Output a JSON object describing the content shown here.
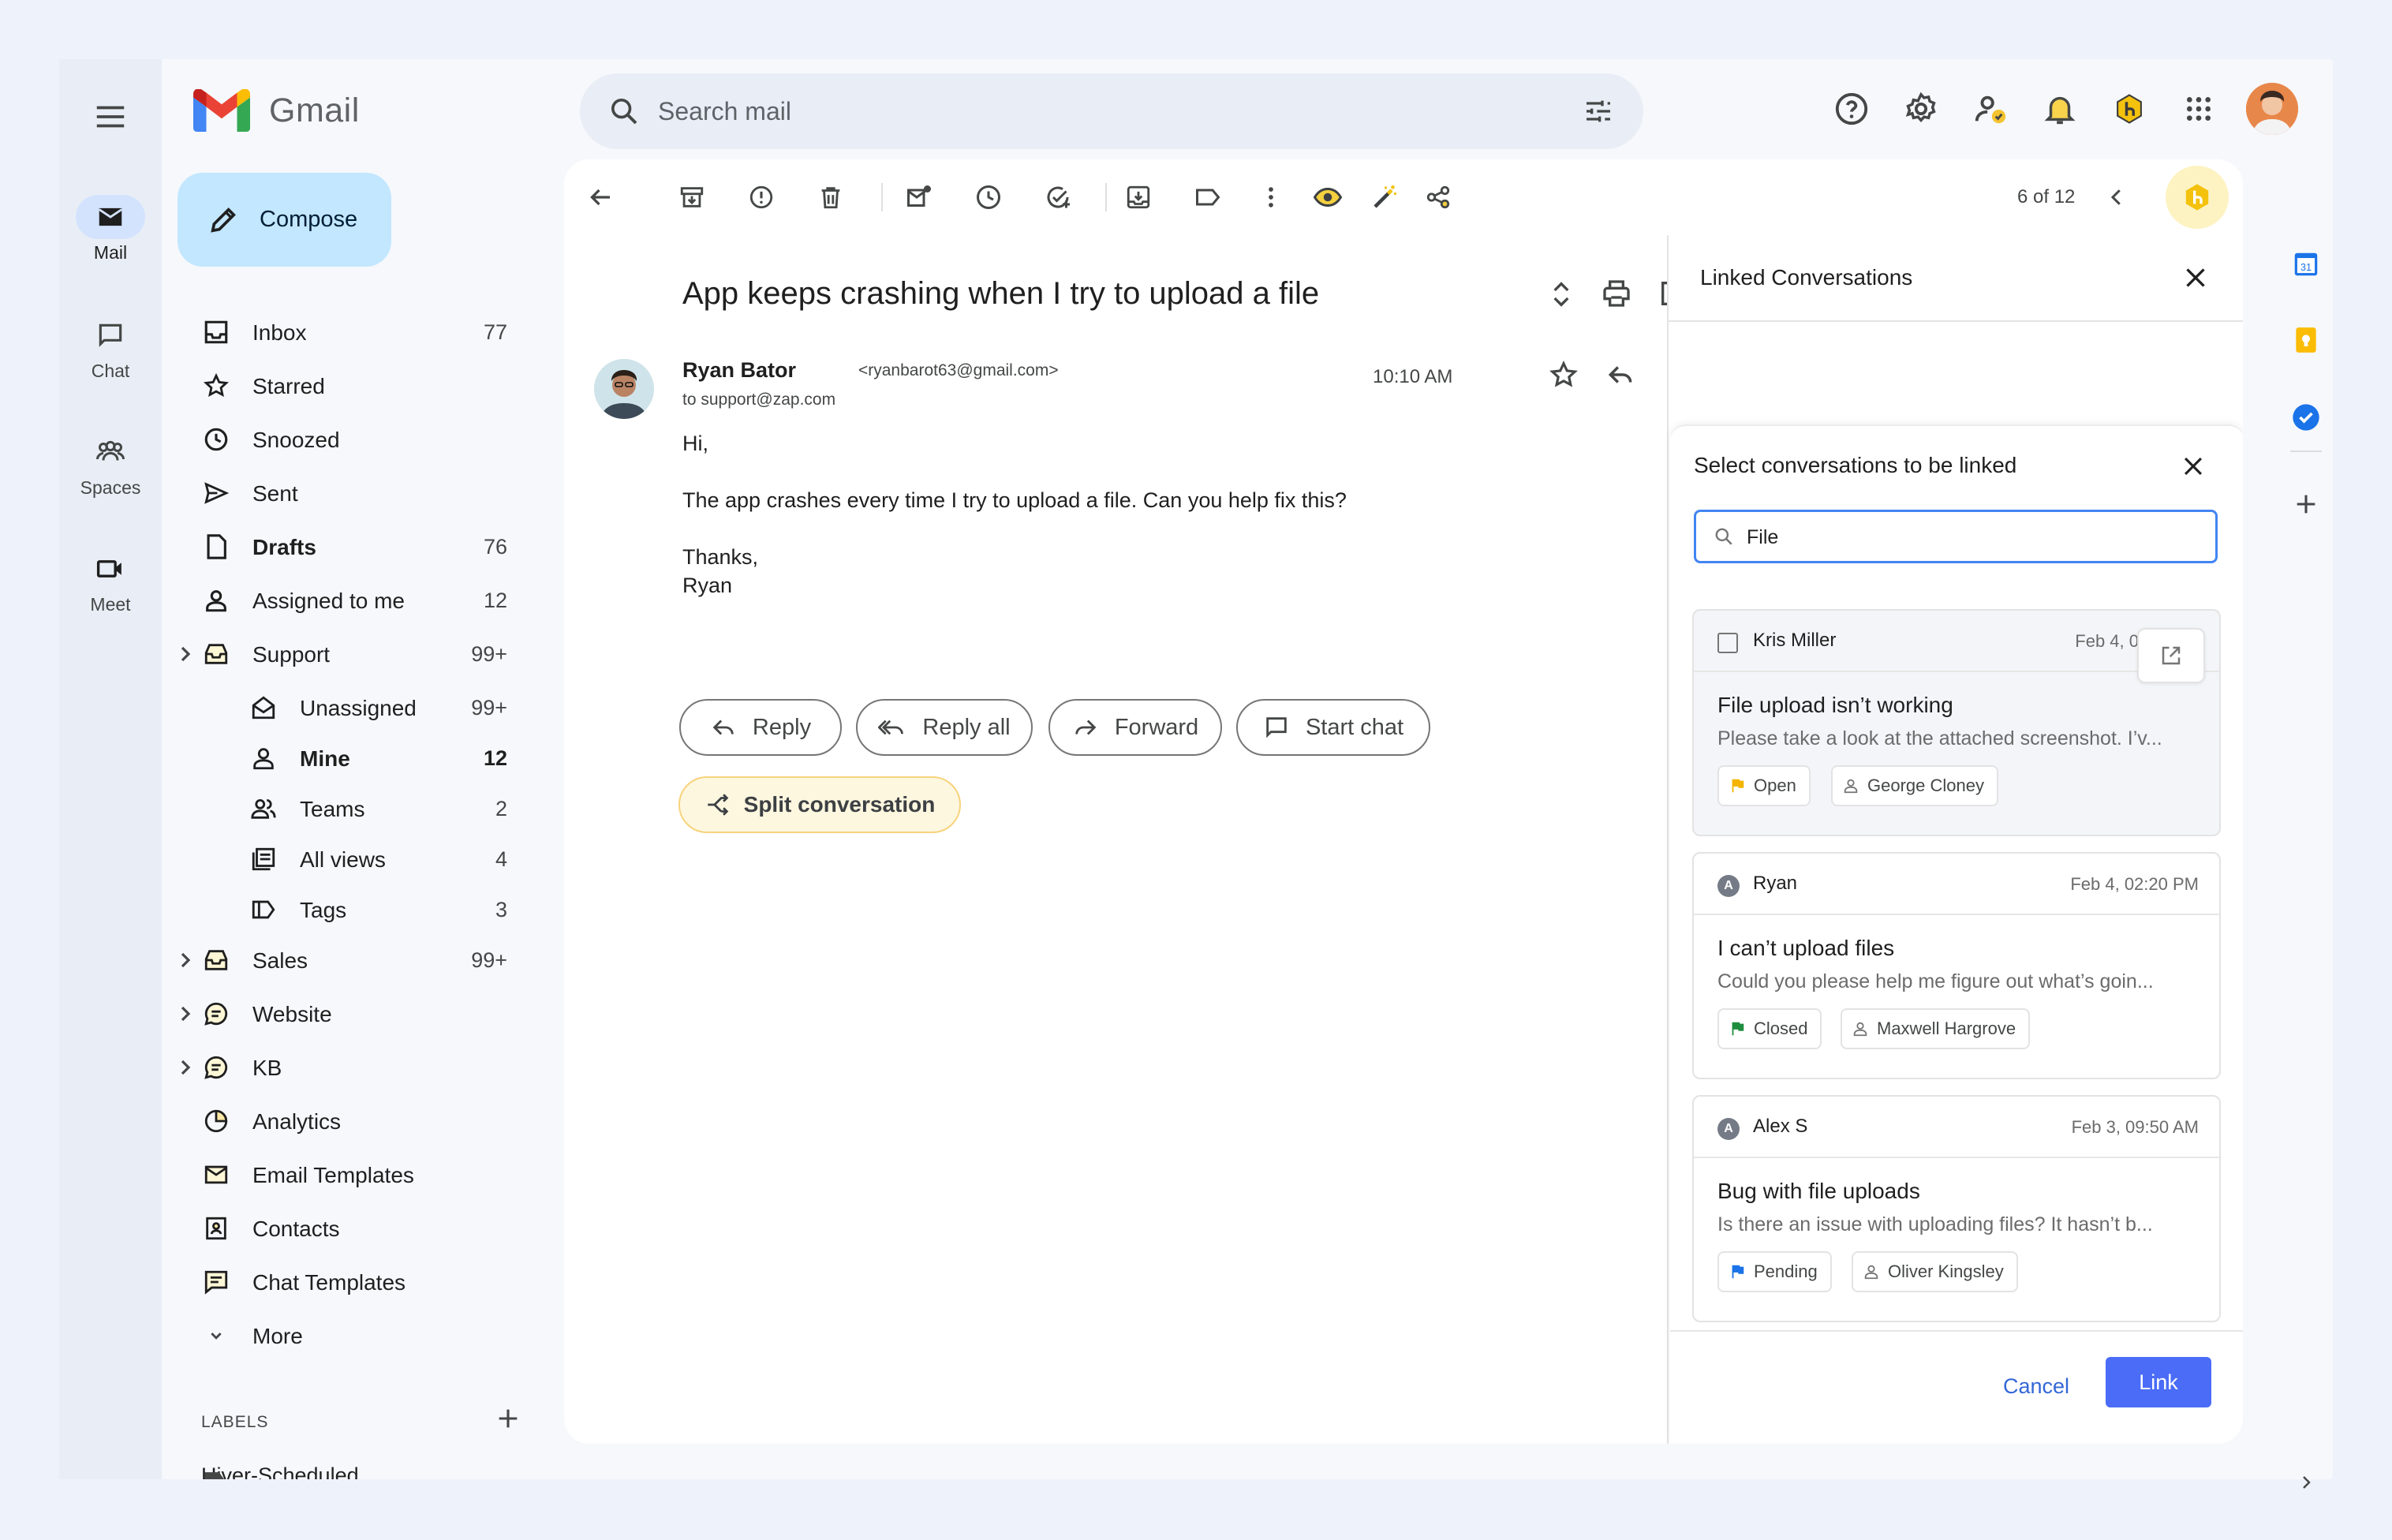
{
  "app": {
    "name": "Gmail"
  },
  "rail": [
    {
      "label": "Mail",
      "icon": "mail-icon",
      "active": true
    },
    {
      "label": "Chat",
      "icon": "chat-icon"
    },
    {
      "label": "Spaces",
      "icon": "spaces-icon"
    },
    {
      "label": "Meet",
      "icon": "meet-icon"
    }
  ],
  "search": {
    "placeholder": "Search mail"
  },
  "compose": {
    "label": "Compose"
  },
  "nav": [
    {
      "label": "Inbox",
      "count": "77"
    },
    {
      "label": "Starred",
      "count": ""
    },
    {
      "label": "Snoozed",
      "count": ""
    },
    {
      "label": "Sent",
      "count": ""
    },
    {
      "label": "Drafts",
      "count": "76"
    },
    {
      "label": "Assigned to me",
      "count": "12"
    },
    {
      "label": "Support",
      "count": "99+"
    },
    {
      "label": "Unassigned",
      "count": "99+"
    },
    {
      "label": "Mine",
      "count": "12"
    },
    {
      "label": "Teams",
      "count": "2"
    },
    {
      "label": "All views",
      "count": "4"
    },
    {
      "label": "Tags",
      "count": "3"
    },
    {
      "label": "Sales",
      "count": "99+"
    },
    {
      "label": "Website",
      "count": ""
    },
    {
      "label": "KB",
      "count": ""
    },
    {
      "label": "Analytics",
      "count": ""
    },
    {
      "label": "Email Templates",
      "count": ""
    },
    {
      "label": "Contacts",
      "count": ""
    },
    {
      "label": "Chat Templates",
      "count": ""
    },
    {
      "label": "More",
      "count": ""
    }
  ],
  "labels": {
    "heading": "LABELS",
    "first": "Hiver-Scheduled"
  },
  "toolbar": {
    "pager": "6 of 12"
  },
  "message": {
    "subject": "App keeps crashing when I try to upload a file",
    "sender_name": "Ryan Bator",
    "sender_email": "<ryanbarot63@gmail.com>",
    "to": "to support@zap.com",
    "time": "10:10 AM",
    "body": [
      "Hi,",
      "The app crashes every time I try to upload a file. Can you help fix this?",
      "Thanks,",
      "Ryan"
    ]
  },
  "actions": {
    "reply": "Reply",
    "reply_all": "Reply all",
    "forward": "Forward",
    "start_chat": "Start chat",
    "split": "Split conversation"
  },
  "linked": {
    "title": "Linked Conversations",
    "modal_title": "Select conversations to be linked",
    "search_value": "File",
    "cancel": "Cancel",
    "link": "Link",
    "results": [
      {
        "name": "Kris Miller",
        "date": "Feb 4, 0",
        "title": "File upload isn’t working",
        "preview": "Please take a look at the attached screenshot. I’v...",
        "status": "Open",
        "status_color": "#f4b400",
        "assignee": "George Cloney"
      },
      {
        "name": "Ryan",
        "avatar": "A",
        "date": "Feb 4, 02:20 PM",
        "title": "I can’t upload files",
        "preview": "Could you please help me figure out what’s goin...",
        "status": "Closed",
        "status_color": "#1e8e3e",
        "assignee": "Maxwell Hargrove"
      },
      {
        "name": "Alex S",
        "avatar": "A",
        "date": "Feb 3, 09:50 AM",
        "title": "Bug with file uploads",
        "preview": "Is there an issue with uploading files? It hasn’t b...",
        "status": "Pending",
        "status_color": "#1a73e8",
        "assignee": "Oliver Kingsley"
      }
    ]
  },
  "side_panel": {
    "calendar_day": "31"
  }
}
